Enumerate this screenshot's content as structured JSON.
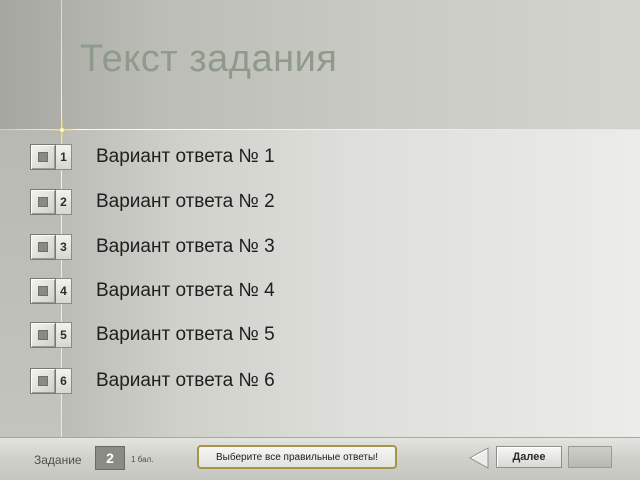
{
  "header": {
    "title": "Текст задания"
  },
  "options": [
    {
      "number": "1",
      "label": "Вариант ответа № 1"
    },
    {
      "number": "2",
      "label": "Вариант ответа № 2"
    },
    {
      "number": "3",
      "label": "Вариант ответа № 3"
    },
    {
      "number": "4",
      "label": "Вариант ответа № 4"
    },
    {
      "number": "5",
      "label": "Вариант ответа № 5"
    },
    {
      "number": "6",
      "label": "Вариант ответа № 6"
    }
  ],
  "footer": {
    "task_label": "Задание",
    "task_number": "2",
    "score": "1 бал.",
    "hint": "Выберите все правильные ответы!",
    "next_label": "Далее"
  },
  "icons": {
    "decoration": "cross-star-icon",
    "back": "triangle-left-icon"
  },
  "colors": {
    "title": "#8e9a8a",
    "hint_border": "#a79349",
    "task_number_bg": "#8b8b85"
  }
}
